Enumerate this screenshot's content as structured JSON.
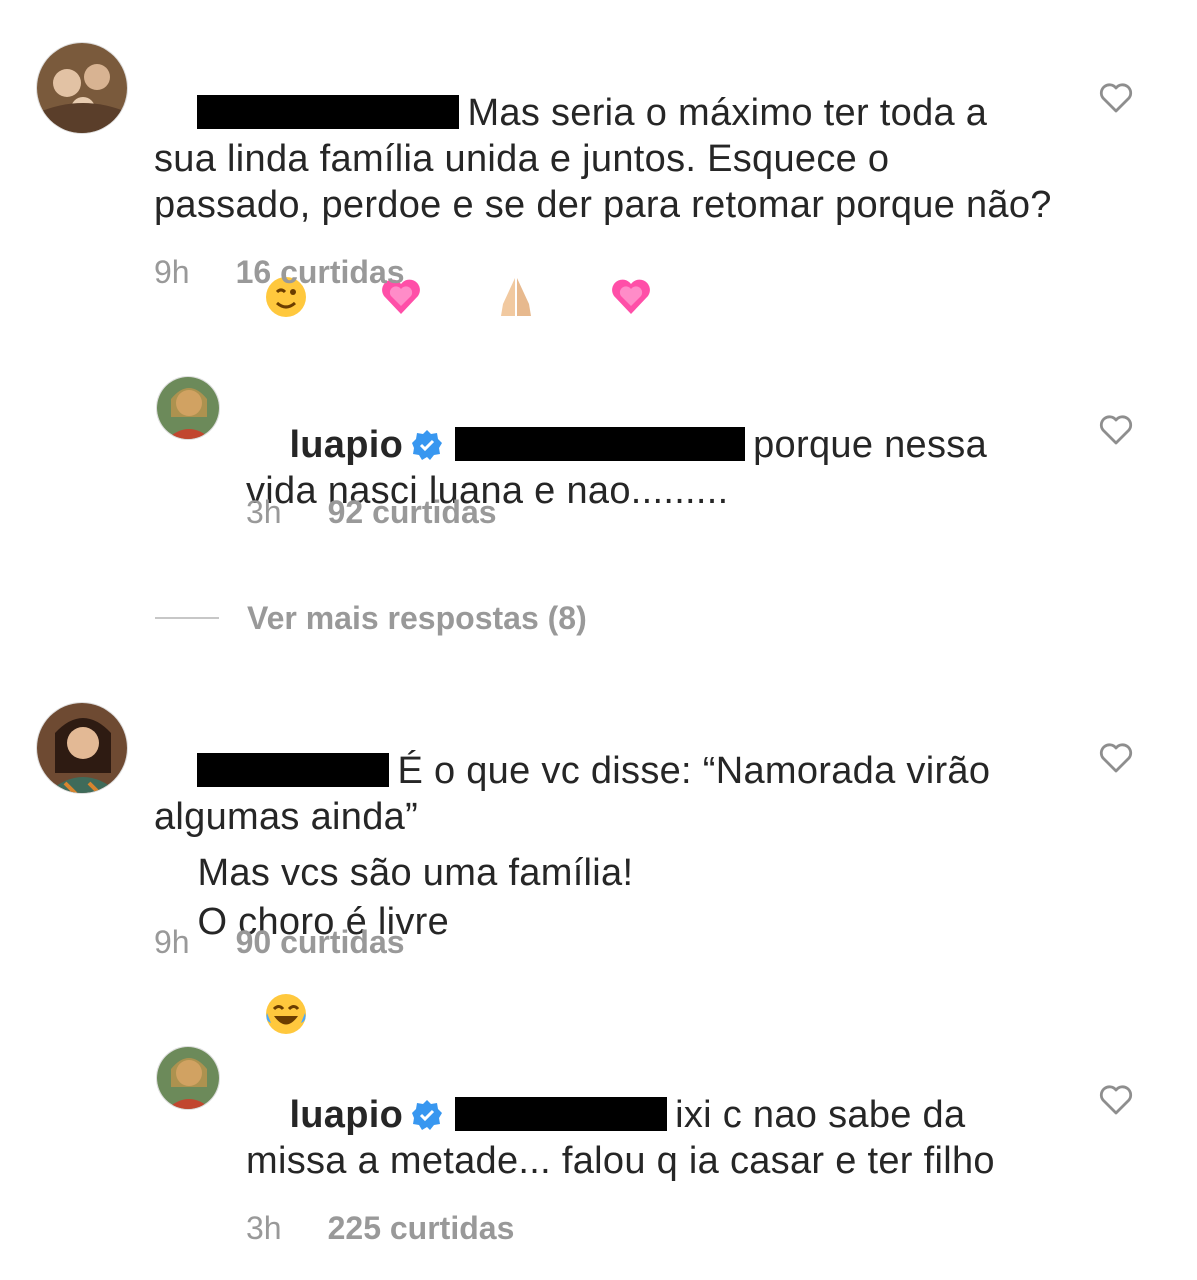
{
  "comments": [
    {
      "text": "Mas seria o máximo ter toda a sua linda família unida e juntos. Esquece o passado, perdoe e se der para retomar porque não?",
      "time": "9h",
      "likes": "16 curtidas",
      "emoji": [
        "winking-face",
        "growing-heart",
        "folded-hands",
        "growing-heart"
      ]
    },
    {
      "username": "luapio",
      "text": "porque nessa vida nasci luana e nao.........",
      "time": "3h",
      "likes": "92 curtidas"
    },
    {
      "text_line1": "É o que vc disse: “Namorada virão algumas ainda”",
      "text_line2": "Mas vcs são uma família!",
      "text_line3": "O choro é livre",
      "time": "9h",
      "likes": "90 curtidas",
      "emoji": [
        "face-with-tears-of-joy"
      ]
    },
    {
      "username": "luapio",
      "text": "ixi c nao sabe da missa a metade... falou q ia casar e ter filho",
      "time": "3h",
      "likes": "225 curtidas"
    }
  ],
  "view_more": "Ver mais respostas (8)",
  "colors": {
    "text": "#262626",
    "meta": "#999999",
    "verified": "#3897f0",
    "heart": "#8e8e8e",
    "emoji_heart": "#ff4fa8"
  }
}
